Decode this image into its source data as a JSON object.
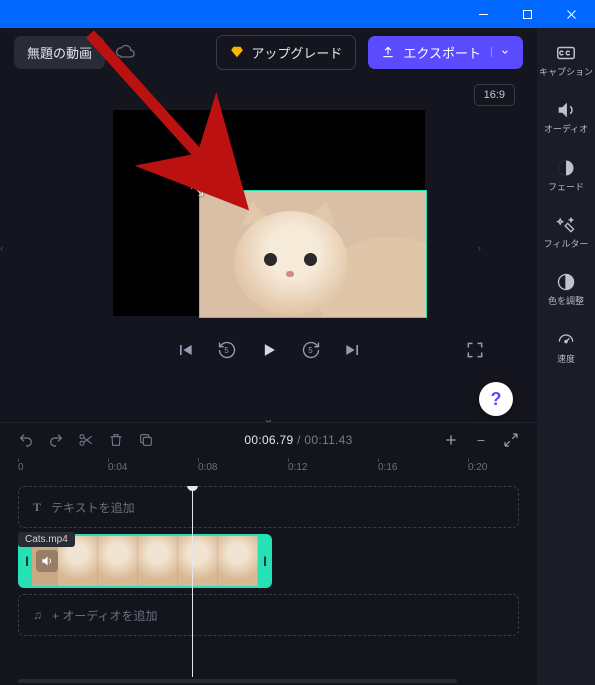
{
  "titlebar": {},
  "toolbar": {
    "project_title": "無題の動画",
    "upgrade_label": "アップグレード",
    "export_label": "エクスポート"
  },
  "preview": {
    "aspect_label": "16:9",
    "help_label": "?"
  },
  "side_rail": [
    {
      "key": "captions",
      "label": "キャプション"
    },
    {
      "key": "audio",
      "label": "オーディオ"
    },
    {
      "key": "fade",
      "label": "フェード"
    },
    {
      "key": "filter",
      "label": "フィルター"
    },
    {
      "key": "color",
      "label": "色を調整"
    },
    {
      "key": "speed",
      "label": "速度"
    }
  ],
  "timeline": {
    "current_time": "00:06",
    "current_frac": ".79",
    "sep": " / ",
    "total_time": "00:11",
    "total_frac": ".43",
    "ticks": [
      "0",
      "0:04",
      "0:08",
      "0:12",
      "0:16",
      "0:20"
    ],
    "text_track_label": "テキストを追加",
    "audio_track_label": "+ オーディオを追加",
    "clip_name": "Cats.mp4"
  }
}
